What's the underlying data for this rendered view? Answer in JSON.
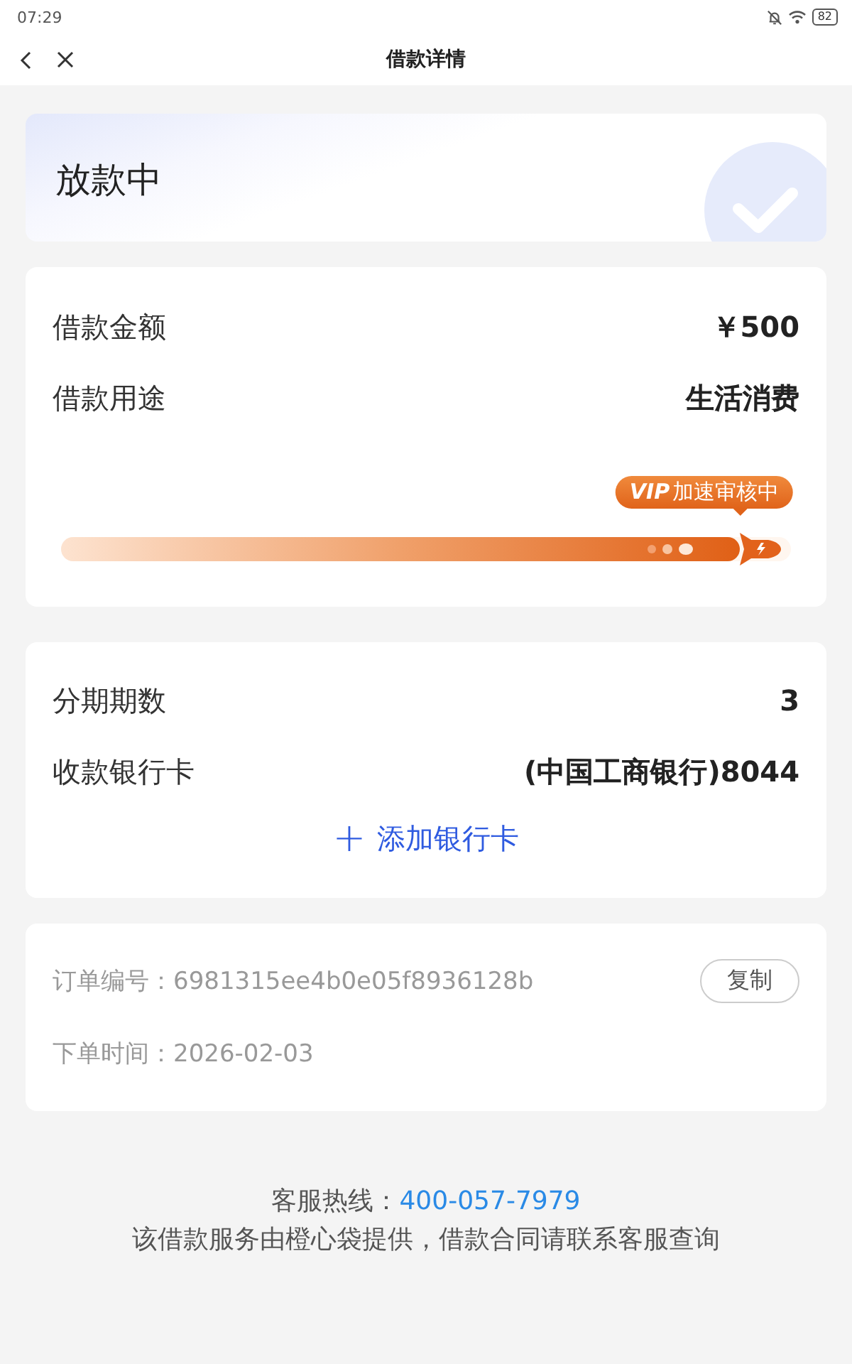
{
  "status_bar": {
    "time": "07:29",
    "battery": "82"
  },
  "nav": {
    "title": "借款详情"
  },
  "status_card": {
    "title": "放款中"
  },
  "loan_card": {
    "rows": [
      {
        "label": "借款金额",
        "value": "￥500"
      },
      {
        "label": "借款用途",
        "value": "生活消费"
      }
    ],
    "progress": {
      "badge_mark": "VIP",
      "badge_text": "加速审核中",
      "level": 0.93
    }
  },
  "repay_card": {
    "rows": [
      {
        "label": "分期期数",
        "value": "3"
      },
      {
        "label": "收款银行卡",
        "value": "(中国工商银行)8044"
      }
    ],
    "add_button": {
      "icon": "+",
      "label": "添加银行卡"
    }
  },
  "order_card": {
    "rows": [
      {
        "label": "订单编号：",
        "value": "6981315ee4b0e05f8936128b",
        "action": "复制"
      },
      {
        "label": "下单时间：",
        "value": "2026-02-03"
      }
    ]
  },
  "footer": {
    "hotline_label": "客服热线：",
    "hotline": "400-057-7979",
    "note": "该借款服务由橙心袋提供，借款合同请联系客服查询"
  }
}
